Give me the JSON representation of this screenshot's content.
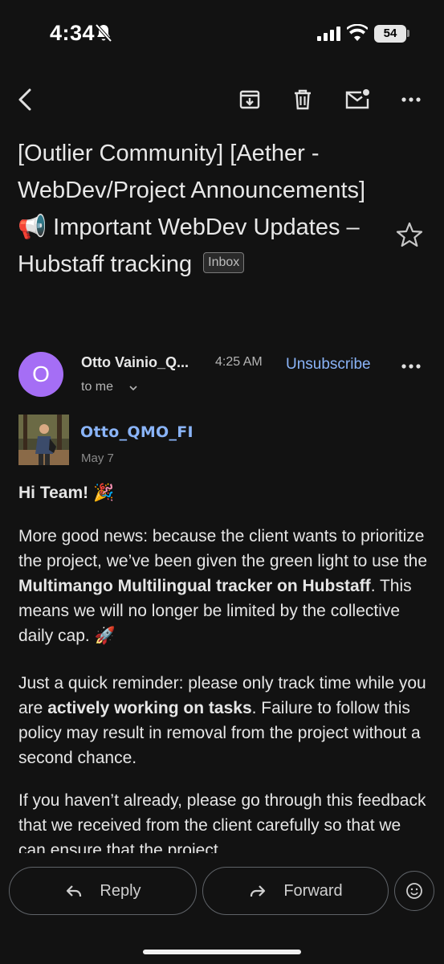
{
  "status_bar": {
    "time": "4:34",
    "battery": "54",
    "icons": [
      "bell-off-icon",
      "signal-icon",
      "wifi-icon",
      "battery-icon"
    ]
  },
  "toolbar": {
    "icons": [
      "back-icon",
      "archive-icon",
      "delete-icon",
      "mark-unread-icon",
      "more-icon"
    ]
  },
  "email": {
    "subject": "[Outlier Community] [Aether - WebDev/Project Announcements] 📢 Important WebDev Updates – Hubstaff tracking",
    "label": "Inbox",
    "sender": {
      "initial": "O",
      "name": "Otto Vainio_Q...",
      "time": "4:25 AM",
      "to": "to me",
      "unsubscribe": "Unsubscribe"
    },
    "author": {
      "name": "Otto_QMO_FI",
      "date": "May 7"
    },
    "greeting": "Hi Team! 🎉",
    "para1": {
      "t1": "More good news: because the client wants to prioritize the project, we’ve been given the green light to use the ",
      "b1": "Multimango Multilingual tracker on Hubstaff",
      "t2": ". This means we will no longer be limited by the collective daily cap. 🚀"
    },
    "para2": {
      "t1": "Just a quick reminder: please only track time while you are ",
      "b1": "actively working on tasks",
      "t2": ". Failure to follow this policy may result in removal from the project without a second chance."
    },
    "para3": "If you haven’t already, please go through this feedback that we received from the client carefully so that we can ensure that the project"
  },
  "actions": {
    "reply": "Reply",
    "forward": "Forward"
  },
  "colors": {
    "background": "#121212",
    "link": "#8ab4f8",
    "avatar": "#a56ef5"
  }
}
